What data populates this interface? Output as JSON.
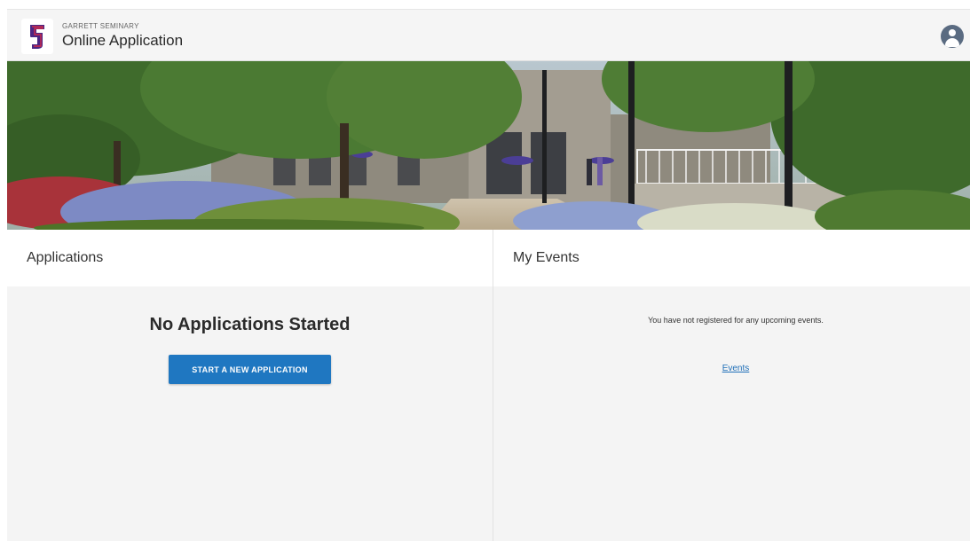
{
  "header": {
    "brand_small": "GARRETT SEMINARY",
    "title": "Online Application",
    "logo_icon": "garrett-seminary-logo",
    "account_icon": "user-account-icon"
  },
  "hero": {
    "description_icon": "campus-photo"
  },
  "applications": {
    "title": "Applications",
    "empty_heading": "No Applications Started",
    "start_button_label": "START A NEW APPLICATION"
  },
  "events": {
    "title": "My Events",
    "empty_message": "You have not registered for any upcoming events.",
    "link_label": "Events"
  },
  "colors": {
    "primary_button": "#1f77c1",
    "link": "#1f6fb8",
    "avatar": "#5a6b81",
    "panel_bg": "#f4f4f4"
  }
}
